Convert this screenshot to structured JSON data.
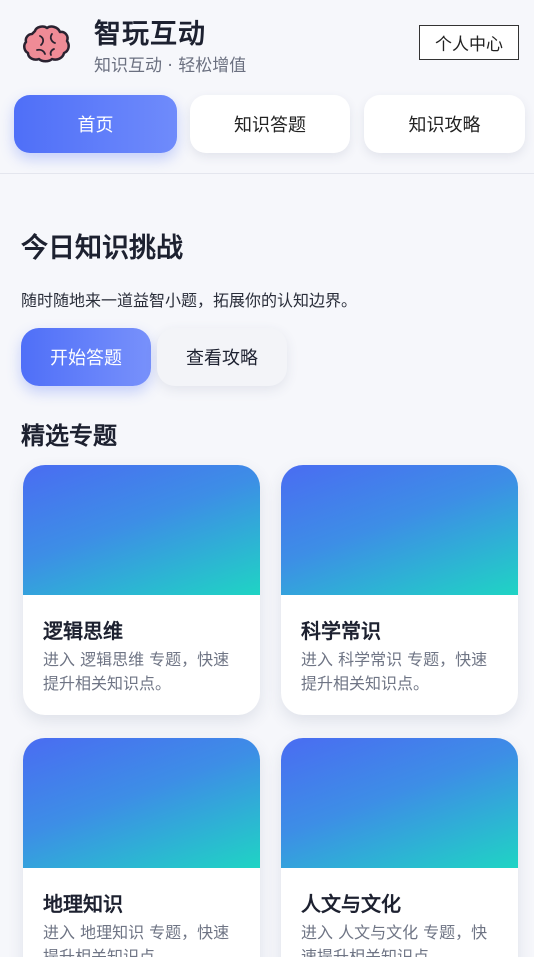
{
  "header": {
    "title": "智玩互动",
    "subtitle": "知识互动 · 轻松增值",
    "profile_label": "个人中心"
  },
  "nav": {
    "tabs": [
      {
        "label": "首页",
        "active": true
      },
      {
        "label": "知识答题",
        "active": false
      },
      {
        "label": "知识攻略",
        "active": false
      }
    ]
  },
  "hero": {
    "title": "今日知识挑战",
    "description": "随时随地来一道益智小题，拓展你的认知边界。",
    "primary_button": "开始答题",
    "secondary_button": "查看攻略"
  },
  "topics": {
    "section_title": "精选专题",
    "cards": [
      {
        "title": "逻辑思维",
        "description": "进入 逻辑思维 专题，快速提升相关知识点。"
      },
      {
        "title": "科学常识",
        "description": "进入 科学常识 专题，快速提升相关知识点。"
      },
      {
        "title": "地理知识",
        "description": "进入 地理知识 专题，快速提升相关知识点。"
      },
      {
        "title": "人文与文化",
        "description": "进入 人文与文化 专题，快速提升相关知识点。"
      }
    ]
  },
  "colors": {
    "accent": "#4f6ff8",
    "cover_start": "#4a6cf2",
    "cover_end": "#1fd4c4",
    "logo": "#ef8b96"
  },
  "icons": {
    "logo": "brain-icon"
  }
}
